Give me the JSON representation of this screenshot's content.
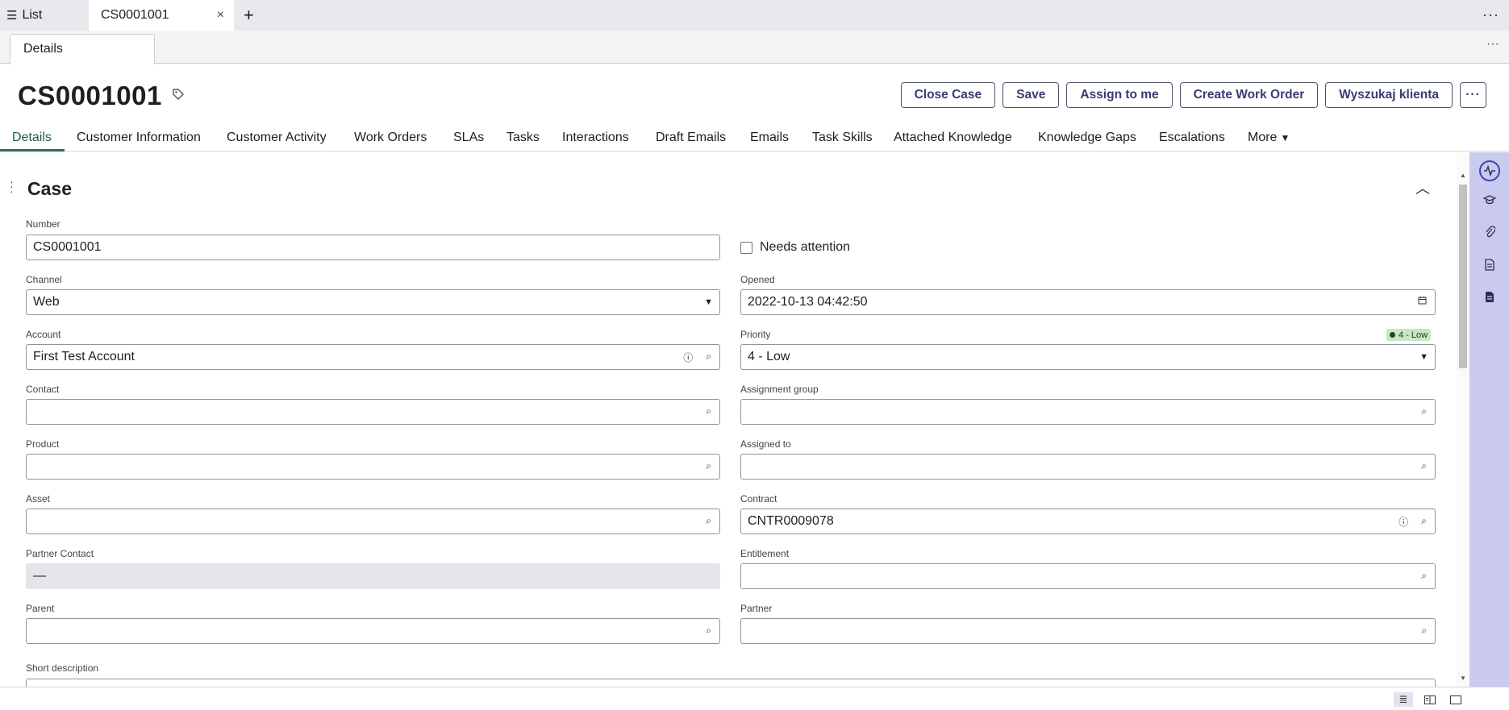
{
  "tabstrip": {
    "list_label": "List",
    "record_tab_label": "CS0001001",
    "close_glyph": "×",
    "add_glyph": "+",
    "more_glyph": "···"
  },
  "subtabs": {
    "details_label": "Details",
    "more_glyph": "···"
  },
  "header": {
    "title": "CS0001001"
  },
  "actions": [
    "Close Case",
    "Save",
    "Assign to me",
    "Create Work Order",
    "Wyszukaj klienta"
  ],
  "actions_more_glyph": "···",
  "section_tabs": [
    "Details",
    "Customer Information",
    "Customer Activity",
    "Work Orders",
    "SLAs",
    "Tasks",
    "Interactions",
    "Draft Emails",
    "Emails",
    "Task Skills",
    "Attached Knowledge",
    "Knowledge Gaps",
    "Escalations"
  ],
  "section_tabs_more": "More",
  "active_section_tab": "Details",
  "section": {
    "title": "Case"
  },
  "form": {
    "number": {
      "label": "Number",
      "value": "CS0001001"
    },
    "needs_attention": {
      "label": "Needs attention",
      "checked": false
    },
    "channel": {
      "label": "Channel",
      "value": "Web"
    },
    "opened": {
      "label": "Opened",
      "value": "2022-10-13 04:42:50"
    },
    "account": {
      "label": "Account",
      "value": "First Test Account"
    },
    "priority": {
      "label": "Priority",
      "value": "4 - Low",
      "badge": "4 - Low"
    },
    "contact": {
      "label": "Contact",
      "value": ""
    },
    "assignment_group": {
      "label": "Assignment group",
      "value": ""
    },
    "product": {
      "label": "Product",
      "value": ""
    },
    "assigned_to": {
      "label": "Assigned to",
      "value": ""
    },
    "asset": {
      "label": "Asset",
      "value": ""
    },
    "contract": {
      "label": "Contract",
      "value": "CNTR0009078"
    },
    "partner_contact": {
      "label": "Partner Contact",
      "value": "—"
    },
    "entitlement": {
      "label": "Entitlement",
      "value": ""
    },
    "parent": {
      "label": "Parent",
      "value": ""
    },
    "partner": {
      "label": "Partner",
      "value": ""
    },
    "short_description": {
      "label": "Short description",
      "value": ""
    }
  },
  "colors": {
    "accent": "#2c6e55",
    "button_text": "#373c74",
    "rail": "#c9caee",
    "badge_bg": "#c8e6c4"
  },
  "icons": [
    "list-icon",
    "tag-icon",
    "info-icon",
    "search-icon",
    "calendar-icon",
    "chevron-down-icon",
    "chevron-up-icon",
    "activity-icon",
    "graduation-cap-icon",
    "paperclip-icon",
    "document-icon",
    "document-filled-icon",
    "view-single-icon",
    "view-split-icon",
    "view-full-icon"
  ]
}
